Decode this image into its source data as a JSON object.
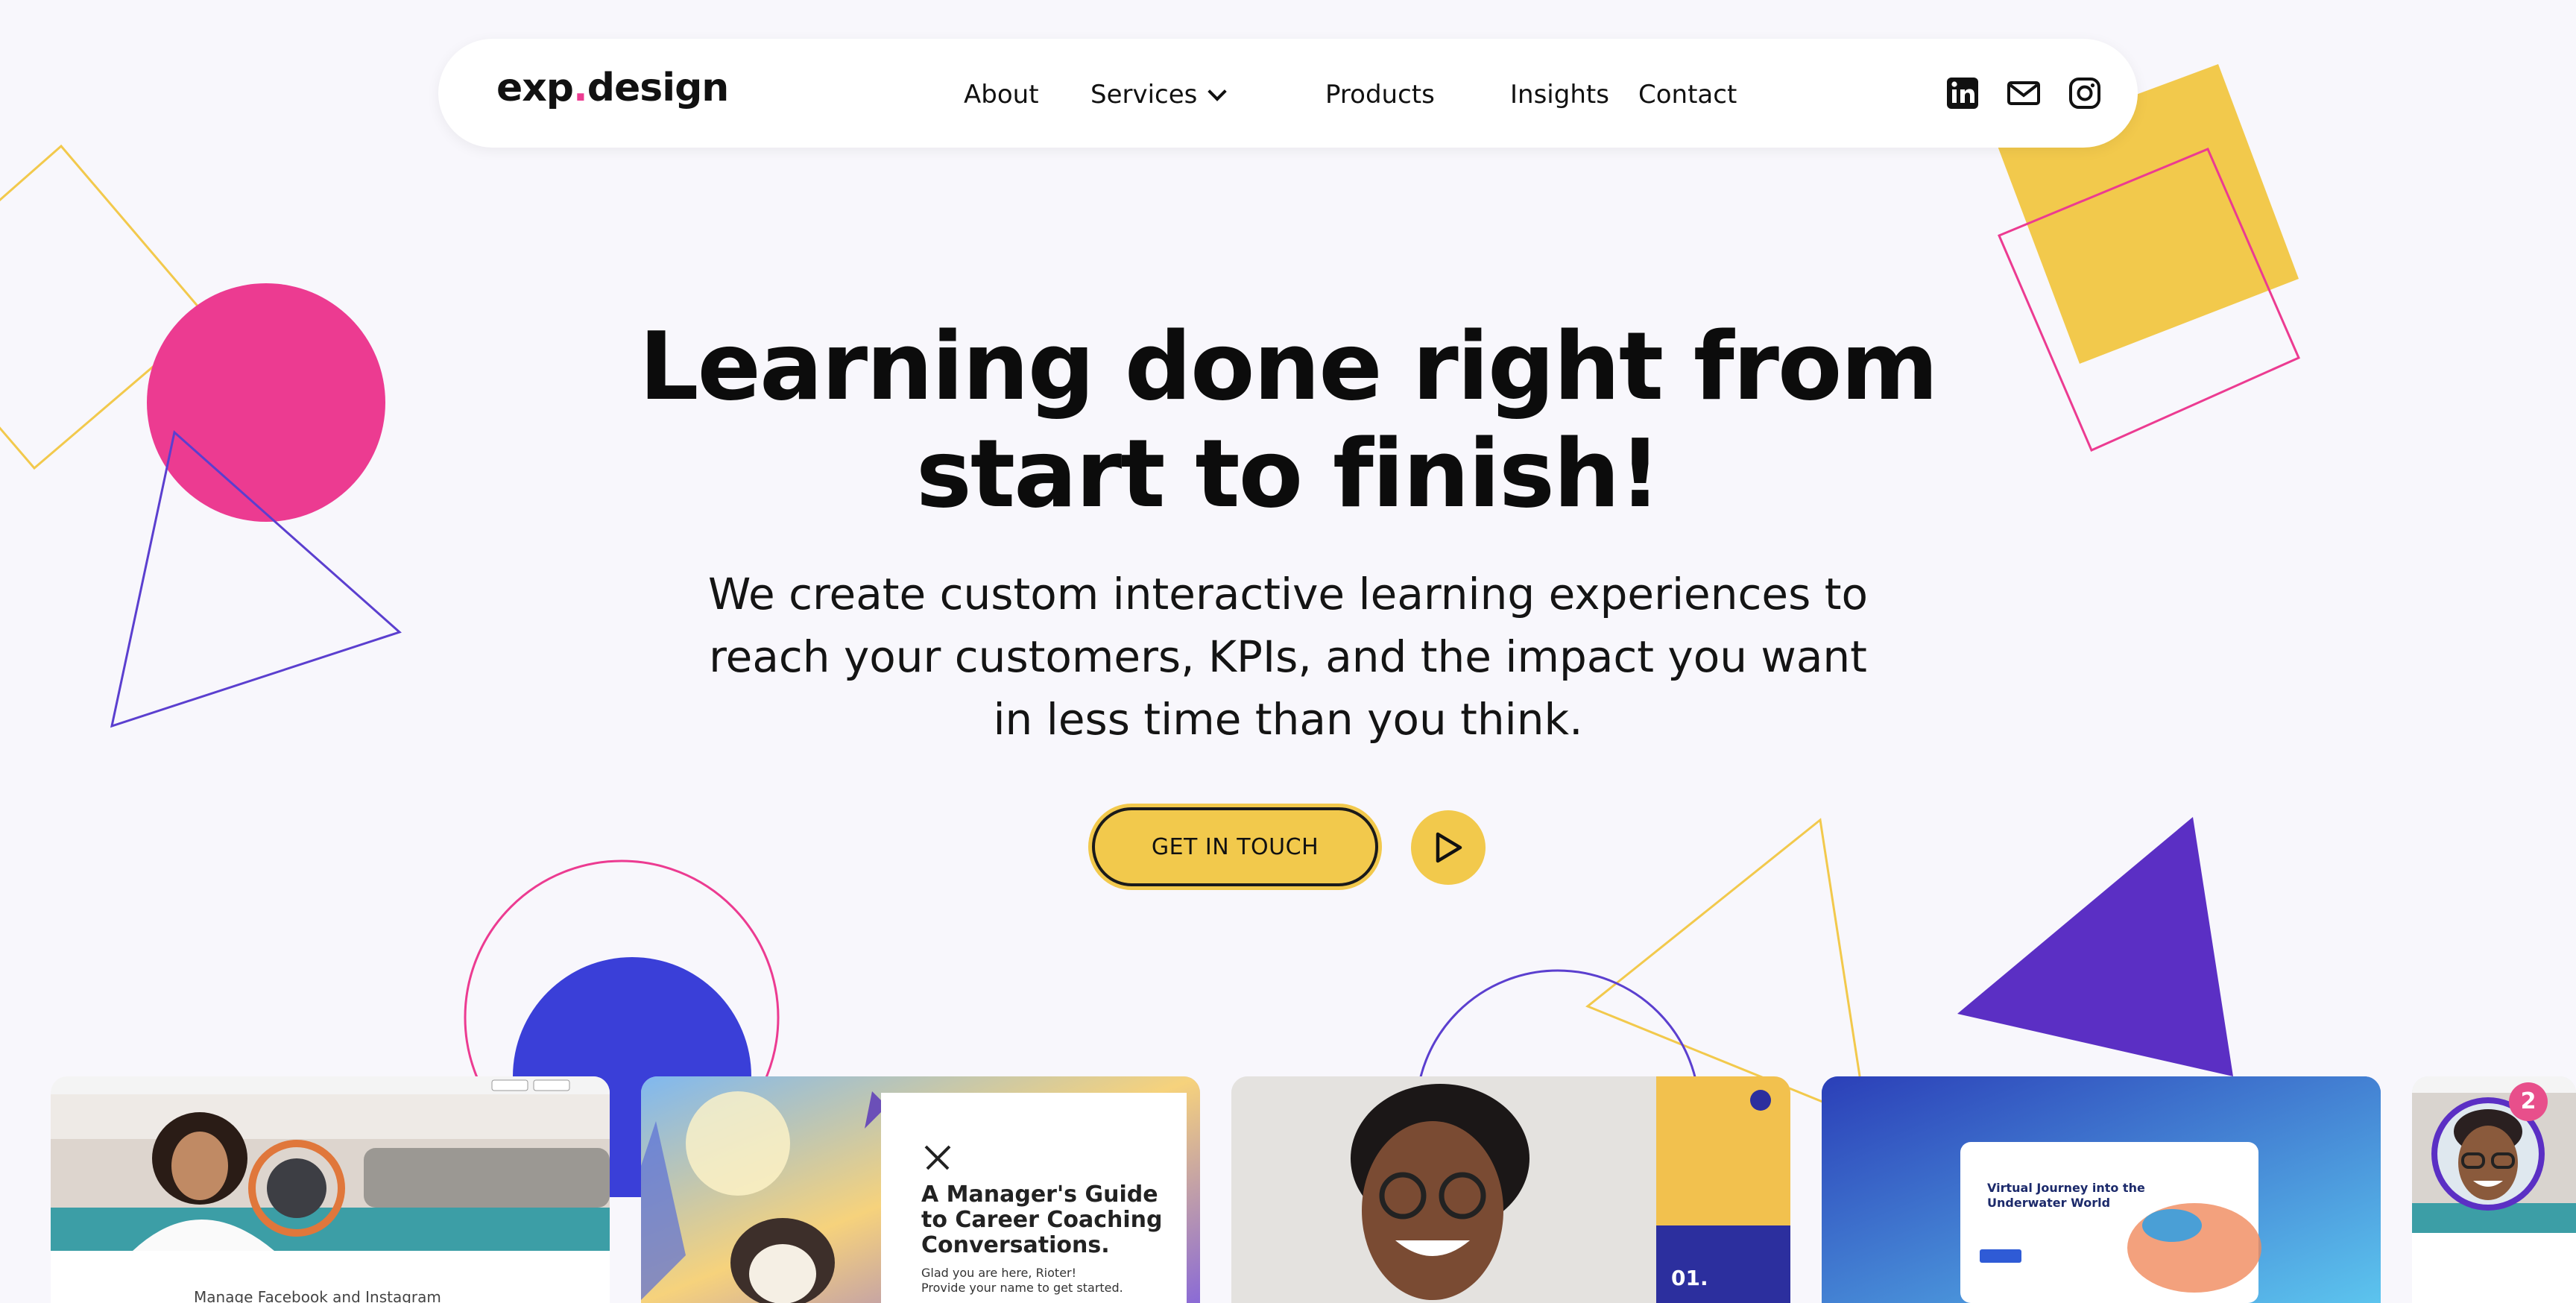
{
  "brand": {
    "logo_left": "exp",
    "logo_dot": ".",
    "logo_right": "design",
    "accent": "#ec3b91"
  },
  "nav": {
    "items": [
      {
        "label": "About"
      },
      {
        "label": "Services",
        "has_dropdown": true
      },
      {
        "label": "Products"
      },
      {
        "label": "Insights"
      },
      {
        "label": "Contact"
      }
    ],
    "social": [
      "linkedin-icon",
      "mail-icon",
      "instagram-icon"
    ]
  },
  "hero": {
    "title_line1": "Learning done right from",
    "title_line2": "start to finish!",
    "subtitle_line1": "We create custom interactive learning experiences to",
    "subtitle_line2": "reach your customers, KPIs, and the impact you want",
    "subtitle_line3": "in less time than you think.",
    "cta_label": "GET IN TOUCH",
    "play_icon": "play-icon"
  },
  "cards": {
    "card1": {
      "caption": "Manage Facebook and Instagram"
    },
    "card2": {
      "title_line1": "A Manager's Guide",
      "title_line2": "to Career Coaching",
      "title_line3": "Conversations.",
      "body_line1": "Glad you are here, Rioter!",
      "body_line2": "Provide your name to get started."
    },
    "card3": {
      "number": "01."
    },
    "card4": {
      "title_line1": "Virtual Journey into the",
      "title_line2": "Underwater World"
    }
  },
  "chat": {
    "notification_count": "2"
  },
  "colors": {
    "background": "#f8f7fc",
    "yellow": "#f2c94c",
    "pink": "#ec3b91",
    "blue": "#3a3fd8",
    "purple": "#5b2fc4"
  }
}
